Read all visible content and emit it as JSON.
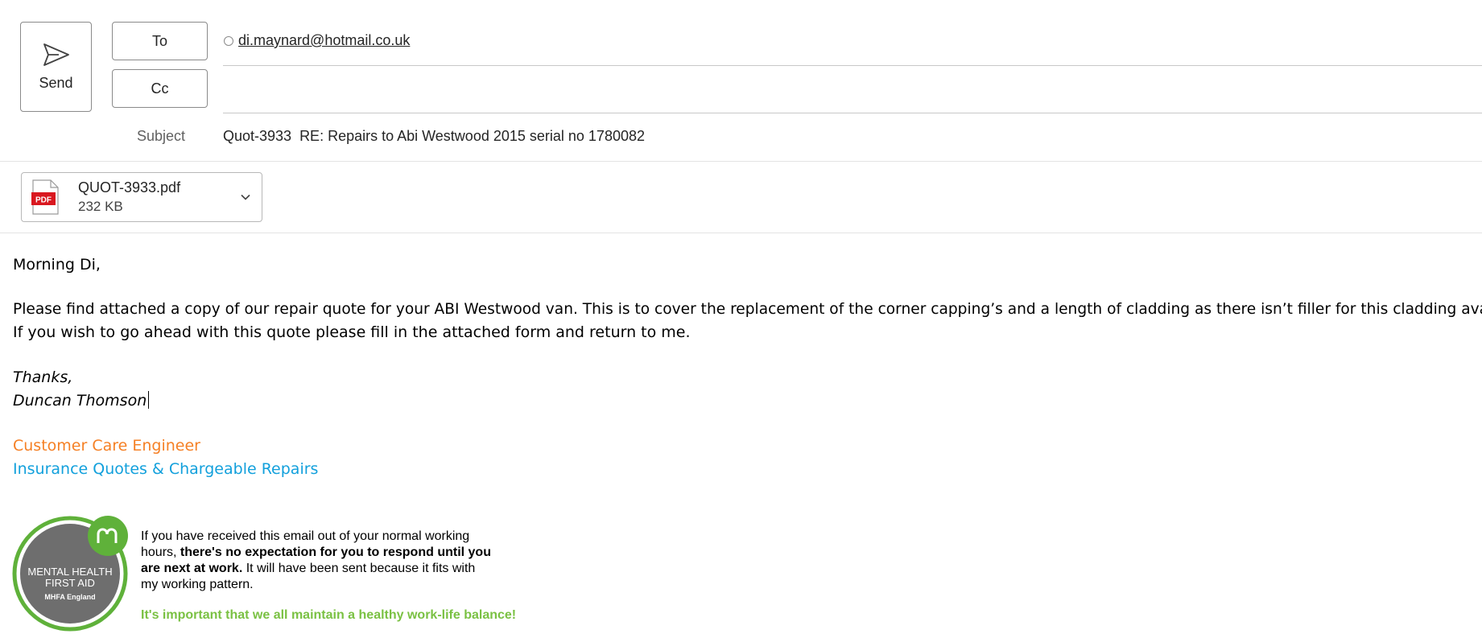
{
  "compose": {
    "send_label": "Send",
    "to_label": "To",
    "cc_label": "Cc",
    "to_recipient": "di.maynard@hotmail.co.uk",
    "subject_label": "Subject",
    "subject_value": "Quot-3933  RE: Repairs to Abi Westwood 2015 serial no 1780082"
  },
  "attachment": {
    "file_name": "QUOT-3933.pdf",
    "file_size": "232 KB",
    "type_badge": "PDF",
    "icon": "pdf-file-icon"
  },
  "body": {
    "greeting": "Morning Di,",
    "line1": "Please find attached a copy of our repair quote for your ABI Westwood van. This is to cover the replacement of the corner capping’s and a length of cladding as there isn’t filler for this cladding available.",
    "line2": "If you wish to go ahead with this quote please fill in the attached form and return to me.",
    "thanks": "Thanks,",
    "name": "Duncan Thomson",
    "title": "Customer Care Engineer",
    "department": "Insurance Quotes & Chargeable Repairs"
  },
  "signature": {
    "logo_line1": "MENTAL HEALTH",
    "logo_line2": "FIRST AID",
    "logo_line3": "MHFA England",
    "notice_a": "If you have received this email out of your normal working hours, ",
    "notice_b": "there's no expectation for you to respond until you are next at work.",
    "notice_c": " It will have been sent because it fits with my working pattern.",
    "balance": "It's important that we all maintain a healthy work-life balance!"
  },
  "colors": {
    "orange": "#f58025",
    "blue": "#12a0dc",
    "green": "#7ac143",
    "pdf_red": "#d9171f"
  }
}
